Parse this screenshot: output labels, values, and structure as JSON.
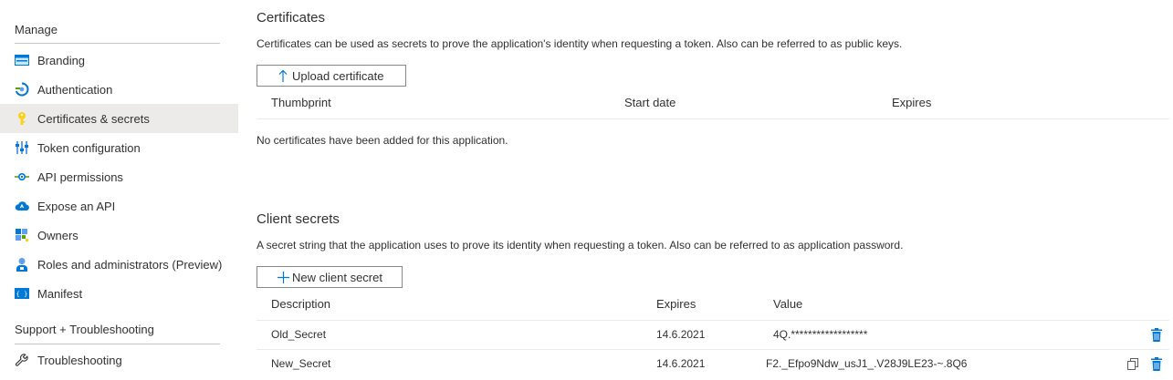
{
  "sidebar": {
    "manage_heading": "Manage",
    "items": [
      {
        "label": "Branding",
        "icon": "branding-icon"
      },
      {
        "label": "Authentication",
        "icon": "authentication-icon"
      },
      {
        "label": "Certificates & secrets",
        "icon": "key-icon",
        "active": true
      },
      {
        "label": "Token configuration",
        "icon": "token-configuration-icon"
      },
      {
        "label": "API permissions",
        "icon": "api-permissions-icon"
      },
      {
        "label": "Expose an API",
        "icon": "cloud-icon"
      },
      {
        "label": "Owners",
        "icon": "owners-icon"
      },
      {
        "label": "Roles and administrators (Preview)",
        "icon": "roles-icon"
      },
      {
        "label": "Manifest",
        "icon": "manifest-icon"
      }
    ],
    "support_heading": "Support + Troubleshooting",
    "support_items": [
      {
        "label": "Troubleshooting",
        "icon": "wrench-icon"
      }
    ]
  },
  "certificates": {
    "title": "Certificates",
    "description": "Certificates can be used as secrets to prove the application's identity when requesting a token. Also can be referred to as public keys.",
    "upload_label": "Upload certificate",
    "columns": [
      "Thumbprint",
      "Start date",
      "Expires"
    ],
    "empty_text": "No certificates have been added for this application."
  },
  "secrets": {
    "title": "Client secrets",
    "description": "A secret string that the application uses to prove its identity when requesting a token. Also can be referred to as application password.",
    "new_label": "New client secret",
    "columns": [
      "Description",
      "Expires",
      "Value"
    ],
    "rows": [
      {
        "description": "Old_Secret",
        "expires": "14.6.2021",
        "value": "4Q.******************"
      },
      {
        "description": "New_Secret",
        "expires": "14.6.2021",
        "value": "F2._Efpo9Ndw_usJ1_.V28J9LE23-~.8Q6"
      }
    ]
  },
  "colors": {
    "accent": "#0078d4",
    "active_bg": "#edebe9",
    "key_yellow": "#fcd116"
  }
}
